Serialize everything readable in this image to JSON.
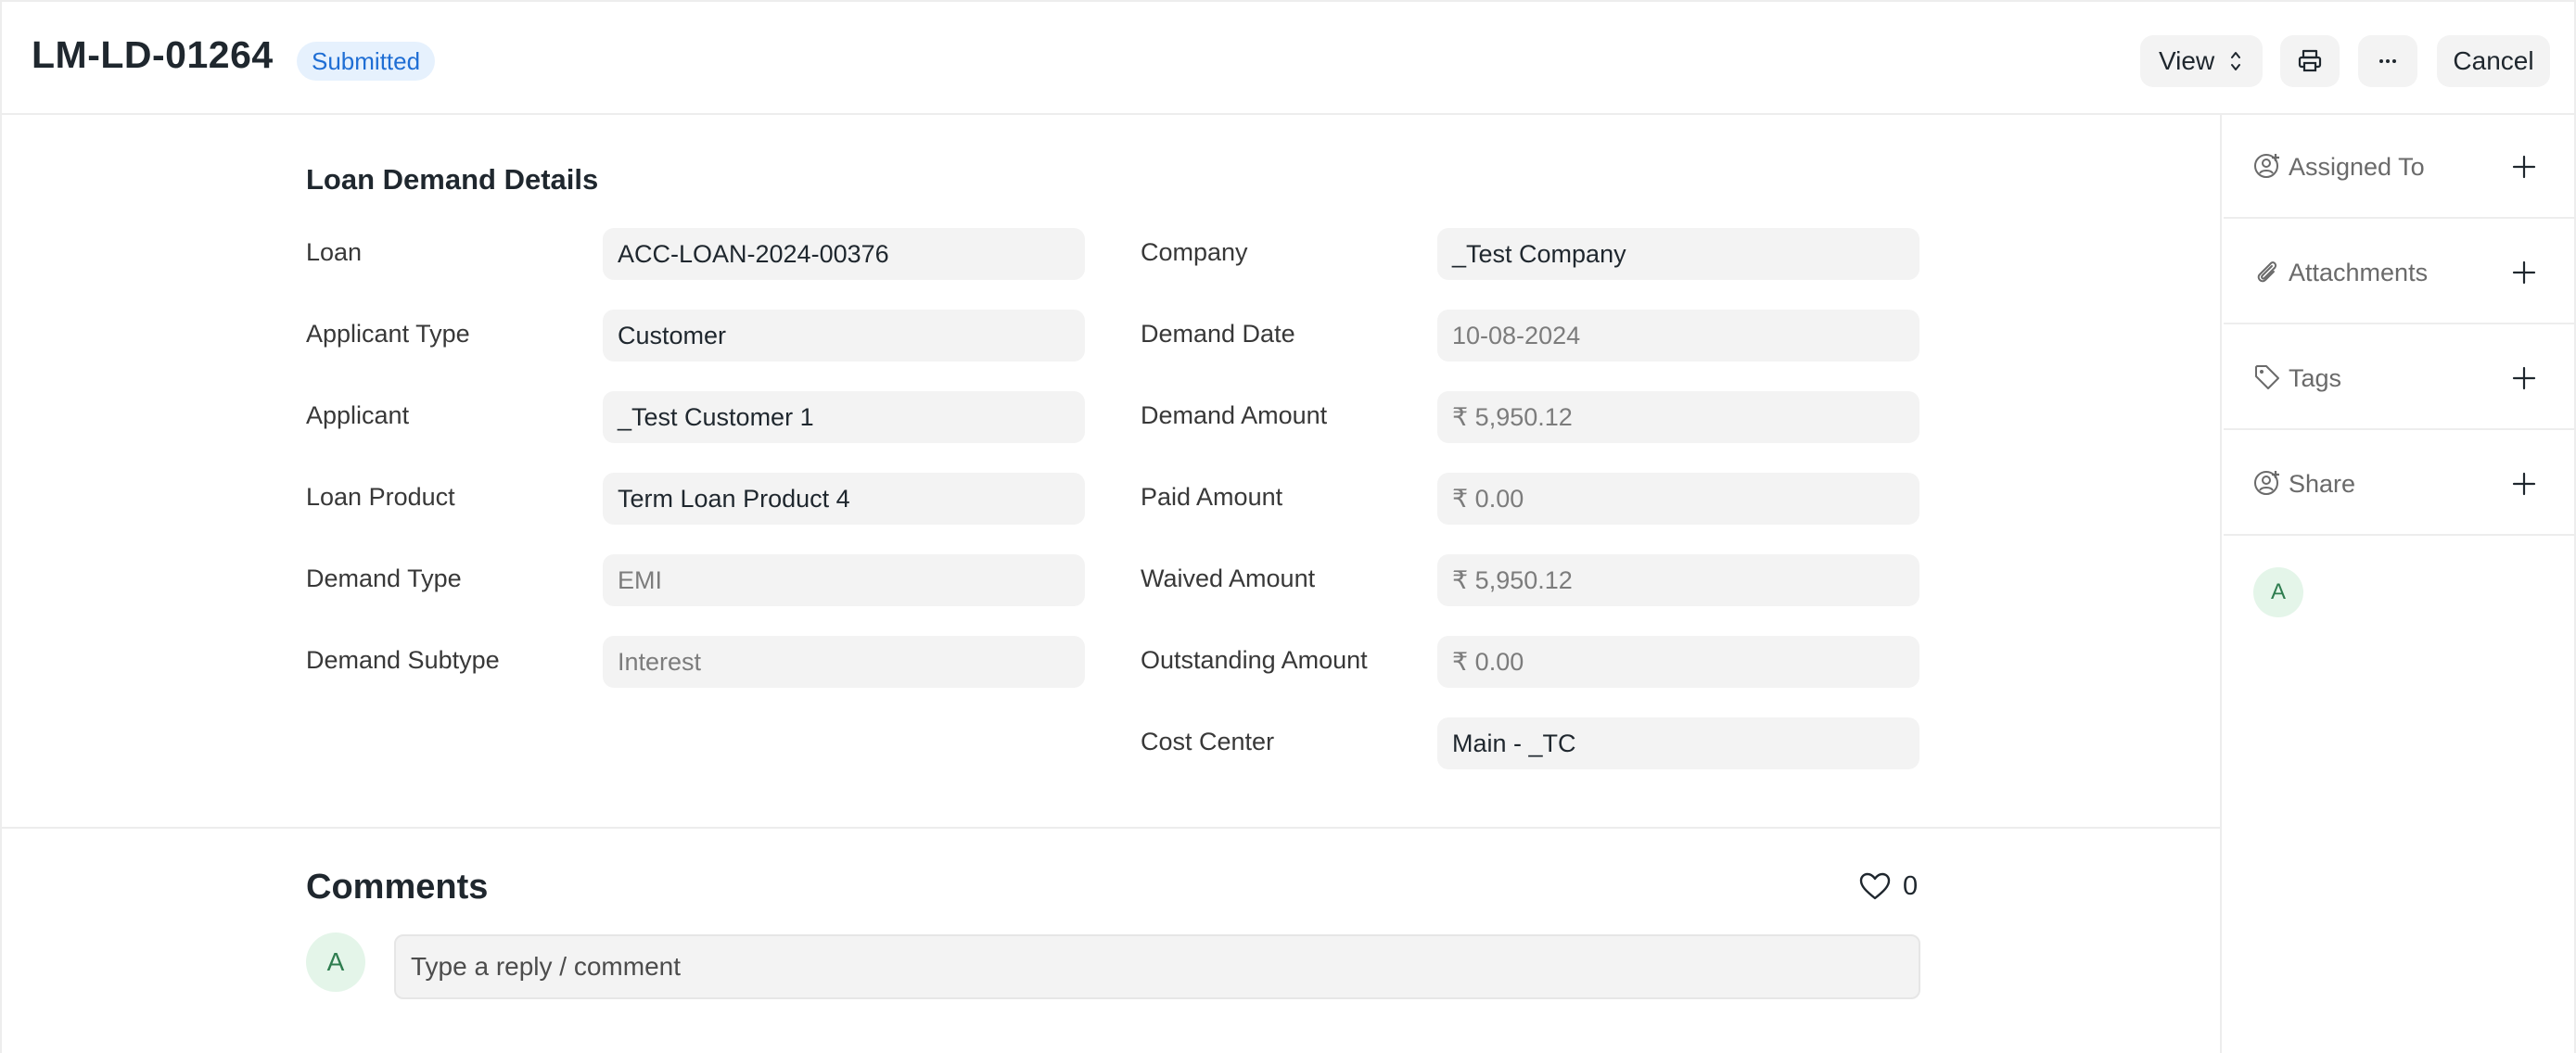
{
  "header": {
    "doc_title": "LM-LD-01264",
    "status": "Submitted",
    "buttons": {
      "view": "View",
      "cancel": "Cancel"
    },
    "icons": [
      "chevron-up-down-icon",
      "printer-icon",
      "more-horizontal-icon"
    ]
  },
  "form": {
    "section_title": "Loan Demand Details",
    "left_fields": [
      {
        "label": "Loan",
        "value": "ACC-LOAN-2024-00376"
      },
      {
        "label": "Applicant Type",
        "value": "Customer"
      },
      {
        "label": "Applicant",
        "value": "_Test Customer 1"
      },
      {
        "label": "Loan Product",
        "value": "Term Loan Product 4"
      },
      {
        "label": "Demand Type",
        "value": "EMI"
      },
      {
        "label": "Demand Subtype",
        "value": "Interest"
      }
    ],
    "right_fields": [
      {
        "label": "Company",
        "value": "_Test Company"
      },
      {
        "label": "Demand Date",
        "value": "10-08-2024"
      },
      {
        "label": "Demand Amount",
        "value": "₹ 5,950.12"
      },
      {
        "label": "Paid Amount",
        "value": "₹ 0.00"
      },
      {
        "label": "Waived Amount",
        "value": "₹ 5,950.12"
      },
      {
        "label": "Outstanding Amount",
        "value": "₹ 0.00"
      },
      {
        "label": "Cost Center",
        "value": "Main - _TC"
      }
    ]
  },
  "comments": {
    "title": "Comments",
    "like_count": "0",
    "avatar_initial": "A",
    "input_placeholder": "Type a reply / comment"
  },
  "sidebar": {
    "items": [
      {
        "label": "Assigned To",
        "icon": "add-user-icon"
      },
      {
        "label": "Attachments",
        "icon": "paperclip-icon"
      },
      {
        "label": "Tags",
        "icon": "tag-icon"
      },
      {
        "label": "Share",
        "icon": "share-user-icon"
      }
    ],
    "avatar_initial": "A"
  },
  "colors": {
    "badge_bg": "#e6f1fd",
    "badge_text": "#1f6ed4",
    "control_bg": "#f3f3f3",
    "avatar_bg": "#e4f5e9",
    "avatar_text": "#2e7d4f"
  }
}
